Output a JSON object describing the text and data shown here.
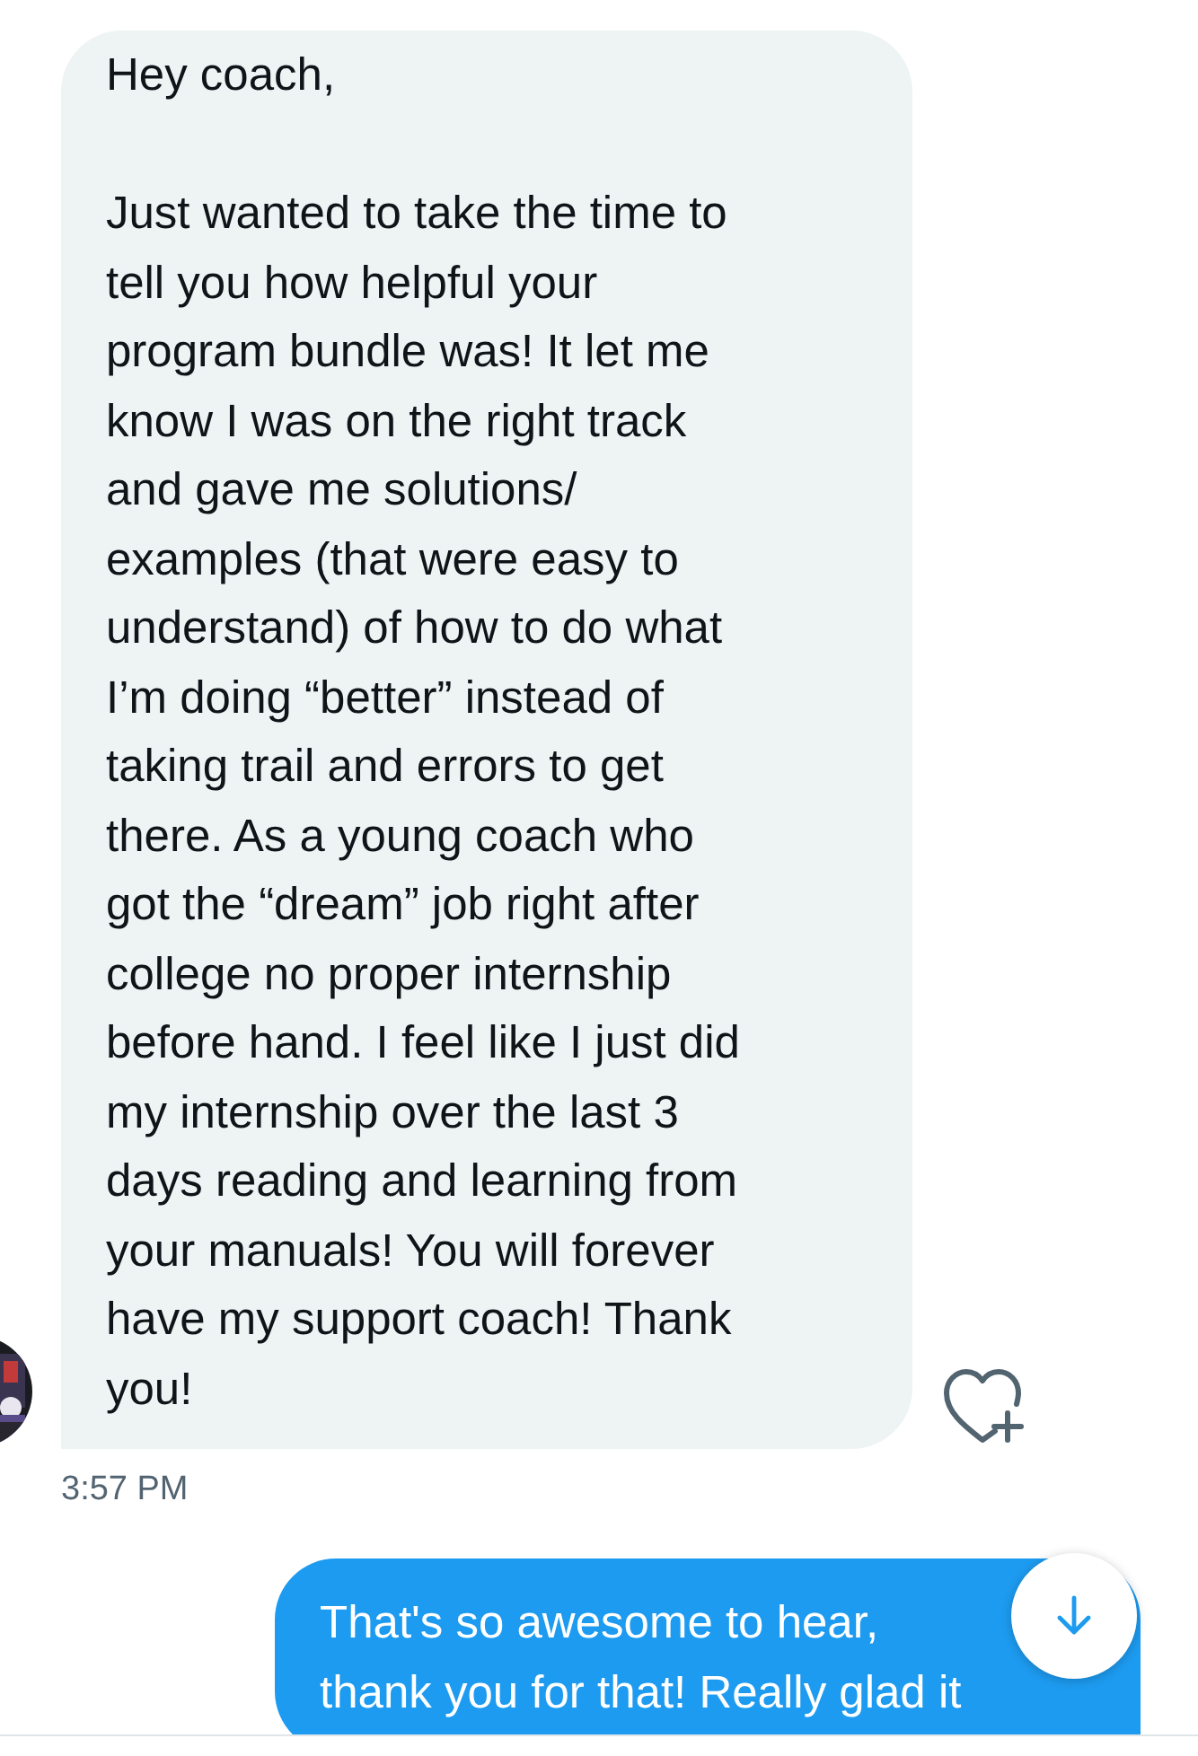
{
  "messages": [
    {
      "kind": "received",
      "time": "3:57 PM",
      "paragraphs": [
        [
          "Hey coach,"
        ],
        [
          "Just wanted to take the time to",
          "tell you how helpful your",
          "program bundle was! It let me",
          "know I was on the right track",
          "and gave me solutions/",
          "examples (that were easy to",
          "understand) of how to do what",
          "I’m doing “better” instead of",
          "taking trail and errors to get",
          "there. As a young coach who",
          "got the “dream” job right after",
          "college no proper internship",
          "before hand. I feel like I just did",
          "my internship over the last 3",
          "days reading and learning from",
          "your manuals! You will forever",
          "have my support coach! Thank",
          "you!"
        ]
      ]
    },
    {
      "kind": "sent",
      "paragraphs": [
        [
          "That's so awesome to hear,",
          "thank you for that! Really glad it"
        ]
      ]
    }
  ]
}
